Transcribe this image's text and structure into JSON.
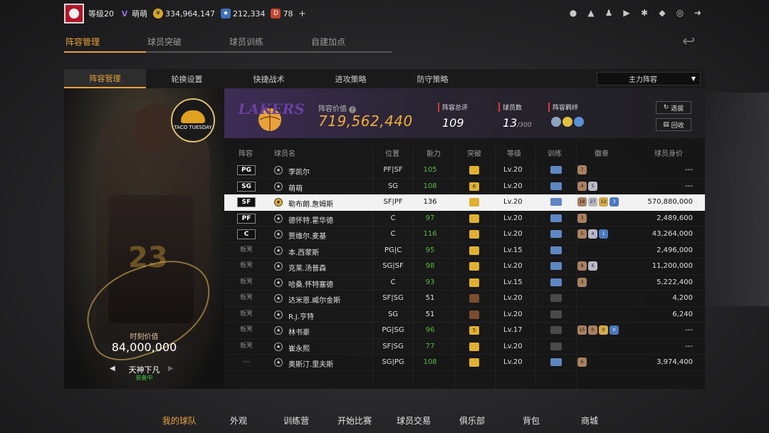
{
  "topbar": {
    "level": "等级20",
    "username": "萌萌",
    "coins": "334,964,147",
    "stars": "212,334",
    "tokens": "78",
    "plus": "+"
  },
  "main_tabs": [
    "阵容管理",
    "球员突破",
    "球员训练",
    "自建加点"
  ],
  "sub_tabs": [
    "阵容管理",
    "轮换设置",
    "快捷战术",
    "进攻策略",
    "防守策略"
  ],
  "squad_select": "主力阵容",
  "hero": {
    "value_label": "时刻价值",
    "value": "84,000,000",
    "name": "天神下凡",
    "equip_status": "装备中",
    "number": "23",
    "badge_text": "TACO TUESDAY"
  },
  "team": {
    "logo_text": "LAKERS",
    "value_label": "阵容价值",
    "value": "719,562,440",
    "rating_label": "阵容总评",
    "rating": "109",
    "count_label": "球员数",
    "count": "13",
    "count_max": "/300",
    "bond_label": "阵容羁绊",
    "pick_btn": "选拔",
    "recycle_btn": "回收"
  },
  "table": {
    "headers": [
      "阵容",
      "球员名",
      "位置",
      "能力",
      "突破",
      "等级",
      "训练",
      "徽章",
      "球员身价"
    ],
    "rows": [
      {
        "slot": "PG",
        "name": "李凯尔",
        "pos": "PF|SF",
        "ability": "105",
        "green": true,
        "breakthrough": "",
        "bt_type": "gold",
        "level": "Lv.20",
        "train": "blue",
        "badges": [
          {
            "t": "b",
            "v": "7"
          }
        ],
        "worth": "---"
      },
      {
        "slot": "SG",
        "name": "萌萌",
        "pos": "SG",
        "ability": "108",
        "green": true,
        "breakthrough": "6",
        "bt_type": "gold",
        "level": "Lv.20",
        "train": "blue",
        "badges": [
          {
            "t": "b",
            "v": "4"
          },
          {
            "t": "s",
            "v": "5"
          }
        ],
        "worth": "---"
      },
      {
        "slot": "SF",
        "name": "勒布朗.詹姆斯",
        "pos": "SF|PF",
        "ability": "136",
        "green": false,
        "breakthrough": "",
        "bt_type": "gold",
        "level": "Lv.20",
        "train": "blue",
        "badges": [
          {
            "t": "b",
            "v": "19"
          },
          {
            "t": "s",
            "v": "27"
          },
          {
            "t": "g",
            "v": "12"
          },
          {
            "t": "bl",
            "v": "3"
          }
        ],
        "worth": "570,880,000",
        "selected": true
      },
      {
        "slot": "PF",
        "name": "德怀特.霍华德",
        "pos": "C",
        "ability": "97",
        "green": true,
        "breakthrough": "",
        "bt_type": "gold",
        "level": "Lv.20",
        "train": "blue",
        "badges": [
          {
            "t": "b",
            "v": "3"
          }
        ],
        "worth": "2,489,600"
      },
      {
        "slot": "C",
        "name": "贾维尔.麦基",
        "pos": "C",
        "ability": "116",
        "green": true,
        "breakthrough": "",
        "bt_type": "gold",
        "level": "Lv.20",
        "train": "blue",
        "badges": [
          {
            "t": "b",
            "v": "5"
          },
          {
            "t": "s",
            "v": "4"
          },
          {
            "t": "bl",
            "v": "1"
          }
        ],
        "worth": "43,264,000"
      },
      {
        "slot": "板凳",
        "name": "本.西蒙斯",
        "pos": "PG|C",
        "ability": "95",
        "green": true,
        "breakthrough": "",
        "bt_type": "gold",
        "level": "Lv.15",
        "train": "blue",
        "badges": [],
        "worth": "2,496,000"
      },
      {
        "slot": "板凳",
        "name": "克莱.汤普森",
        "pos": "SG|SF",
        "ability": "98",
        "green": true,
        "breakthrough": "",
        "bt_type": "gold",
        "level": "Lv.20",
        "train": "blue",
        "badges": [
          {
            "t": "b",
            "v": "8"
          },
          {
            "t": "s",
            "v": "6"
          }
        ],
        "worth": "11,200,000"
      },
      {
        "slot": "板凳",
        "name": "哈桑.怀特塞德",
        "pos": "C",
        "ability": "93",
        "green": true,
        "breakthrough": "",
        "bt_type": "gold",
        "level": "Lv.15",
        "train": "blue",
        "badges": [
          {
            "t": "b",
            "v": "3"
          }
        ],
        "worth": "5,222,400"
      },
      {
        "slot": "板凳",
        "name": "达米恩.威尔金斯",
        "pos": "SF|SG",
        "ability": "51",
        "green": false,
        "breakthrough": "",
        "bt_type": "brown",
        "level": "Lv.20",
        "train": "grey",
        "badges": [],
        "worth": "4,200"
      },
      {
        "slot": "板凳",
        "name": "R.J.亨特",
        "pos": "SG",
        "ability": "51",
        "green": false,
        "breakthrough": "",
        "bt_type": "brown",
        "level": "Lv.20",
        "train": "grey",
        "badges": [],
        "worth": "6,240"
      },
      {
        "slot": "板凳",
        "name": "林书豪",
        "pos": "PG|SG",
        "ability": "96",
        "green": true,
        "breakthrough": "5",
        "bt_type": "gold",
        "level": "Lv.17",
        "train": "grey",
        "badges": [
          {
            "t": "b",
            "v": "15"
          },
          {
            "t": "b",
            "v": "0"
          },
          {
            "t": "g",
            "v": "0"
          },
          {
            "t": "bl",
            "v": "0"
          }
        ],
        "worth": "---"
      },
      {
        "slot": "板凳",
        "name": "崔永熙",
        "pos": "SF|SG",
        "ability": "77",
        "green": true,
        "breakthrough": "",
        "bt_type": "gold",
        "level": "Lv.20",
        "train": "grey",
        "badges": [],
        "worth": "---"
      },
      {
        "slot": "---",
        "name": "奥斯汀.里夫斯",
        "pos": "SG|PG",
        "ability": "108",
        "green": true,
        "breakthrough": "",
        "bt_type": "gold",
        "level": "Lv.20",
        "train": "blue",
        "badges": [
          {
            "t": "b",
            "v": "6"
          }
        ],
        "worth": "3,974,400"
      }
    ]
  },
  "bottom_nav": [
    "我的球队",
    "外观",
    "训练营",
    "开始比赛",
    "球员交易",
    "俱乐部",
    "背包",
    "商城"
  ],
  "colors": {
    "accent": "#e9a23b",
    "green": "#5cb845",
    "lakers_purple": "#3d2d55"
  }
}
